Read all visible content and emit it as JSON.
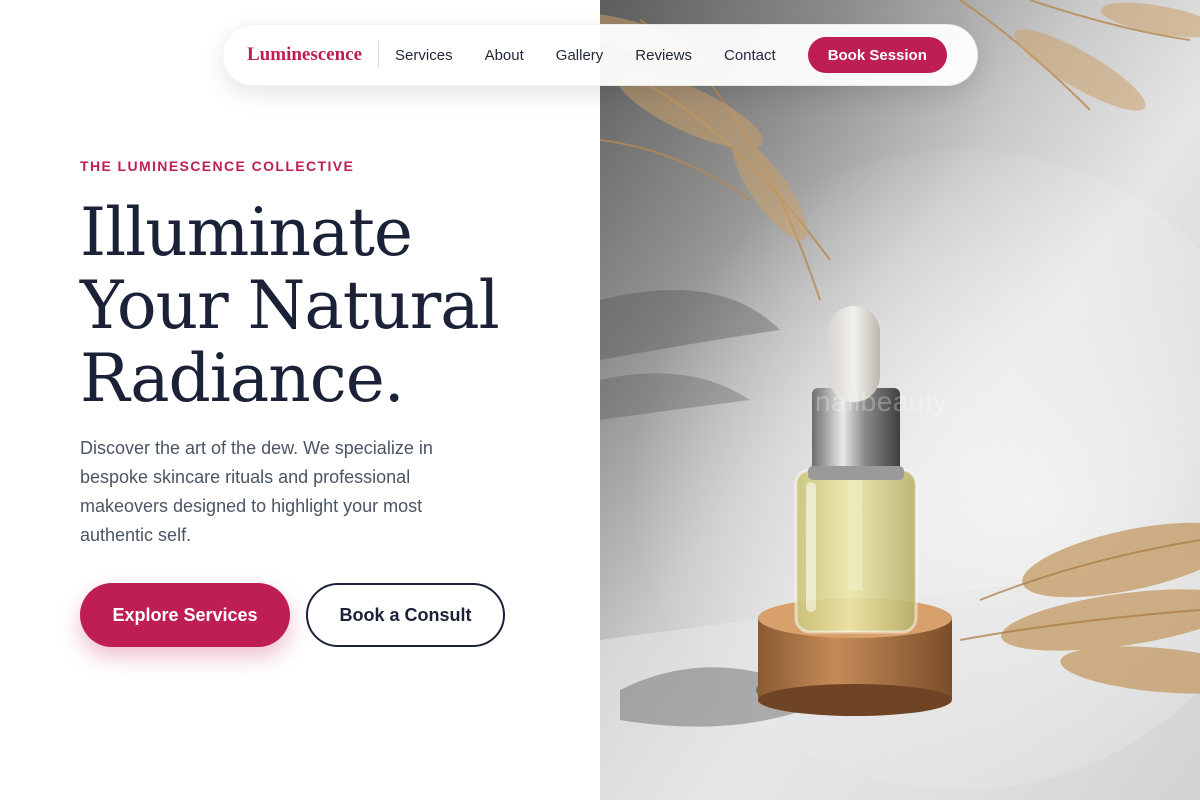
{
  "nav": {
    "brand": "Luminescence",
    "links": [
      {
        "label": "Services"
      },
      {
        "label": "About"
      },
      {
        "label": "Gallery"
      },
      {
        "label": "Reviews"
      },
      {
        "label": "Contact"
      }
    ],
    "cta": "Book Session"
  },
  "hero": {
    "eyebrow": "THE LUMINESCENCE COLLECTIVE",
    "headline": [
      "Illuminate",
      "Your Natural",
      "Radiance."
    ],
    "description": "Discover the art of the dew. We specialize in bespoke skincare rituals and professional makeovers designed to highlight your most authentic self.",
    "primary_cta": "Explore Services",
    "secondary_cta": "Book a Consult"
  },
  "image": {
    "watermark": "naiibeauty"
  },
  "colors": {
    "accent": "#be1e55",
    "heading": "#1b2238",
    "body_text": "#4b5563",
    "background": "#ffffff"
  }
}
